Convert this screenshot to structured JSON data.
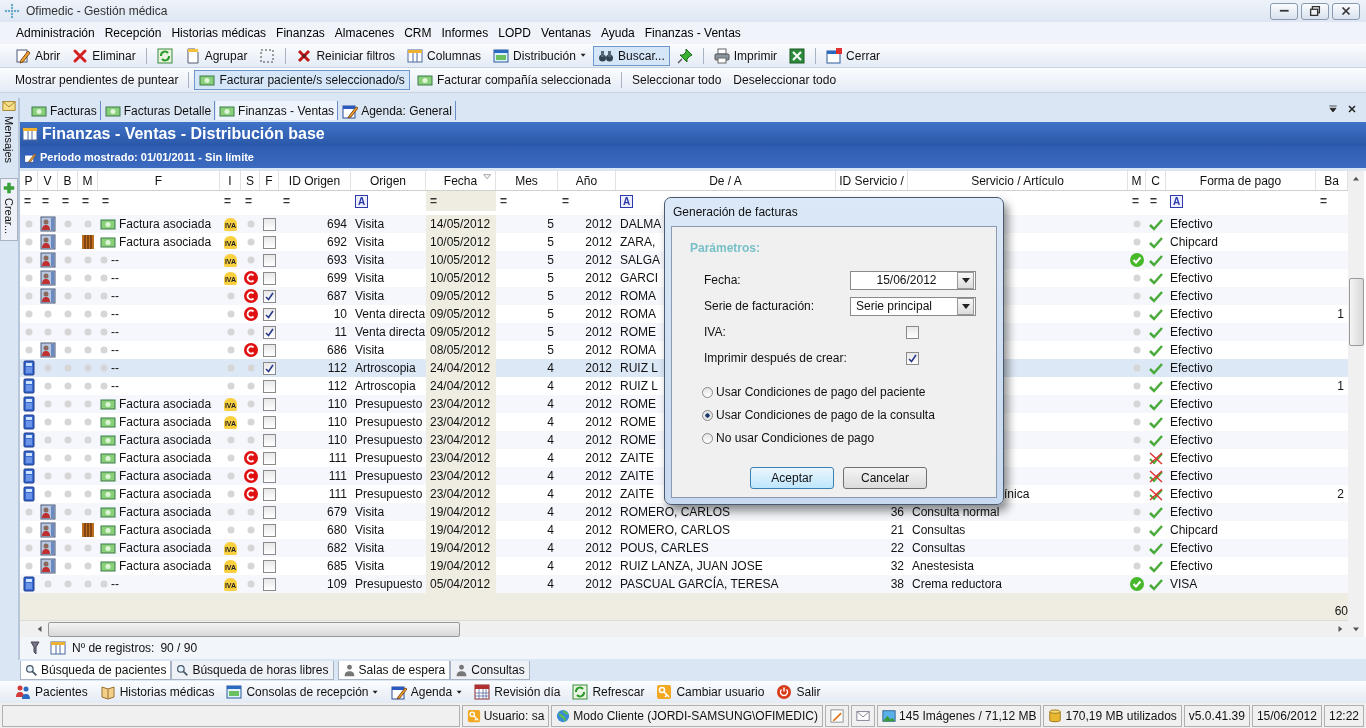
{
  "window": {
    "title": "Ofimedic - Gestión médica"
  },
  "menu": [
    "Administración",
    "Recepción",
    "Historias médicas",
    "Finanzas",
    "Almacenes",
    "CRM",
    "Informes",
    "LOPD",
    "Ventanas",
    "Ayuda",
    "Finanzas - Ventas"
  ],
  "toolbar": [
    {
      "kind": "button",
      "label": "Abrir",
      "selected": false
    },
    {
      "kind": "button",
      "label": "Eliminar",
      "selected": false
    },
    {
      "kind": "icon",
      "selected": false
    },
    {
      "kind": "button",
      "label": "Agrupar",
      "selected": false
    },
    {
      "kind": "icon",
      "selected": false
    },
    {
      "kind": "button",
      "label": "Reiniciar filtros",
      "selected": false
    },
    {
      "kind": "button",
      "label": "Columnas",
      "selected": false
    },
    {
      "kind": "dropdown",
      "label": "Distribución",
      "selected": false
    },
    {
      "kind": "button",
      "label": "Buscar...",
      "selected": true
    },
    {
      "kind": "icon",
      "selected": false
    },
    {
      "kind": "button",
      "label": "Imprimir",
      "selected": false
    },
    {
      "kind": "icon",
      "selected": false
    },
    {
      "kind": "button",
      "label": "Cerrar",
      "selected": false
    }
  ],
  "actions": [
    {
      "label": "Mostrar pendientes de puntear",
      "selected": false
    },
    {
      "label": "Facturar paciente/s seleccionado/s",
      "selected": true
    },
    {
      "label": "Facturar compañía seleccionada",
      "selected": false
    },
    {
      "label": "Seleccionar todo",
      "selected": false
    },
    {
      "label": "Deseleccionar todo",
      "selected": false
    }
  ],
  "side_tabs": [
    "Mensajes",
    "Crear..."
  ],
  "doc_tabs": [
    {
      "label": "Facturas",
      "selected": false
    },
    {
      "label": "Facturas Detalle",
      "selected": false
    },
    {
      "label": "Finanzas - Ventas",
      "selected": true
    },
    {
      "label": "Agenda: General",
      "selected": false
    }
  ],
  "panel": {
    "title": "Finanzas - Ventas - Distribución base",
    "period": "Periodo mostrado: 01/01/2011 - Sin límite"
  },
  "grid": {
    "columns": [
      {
        "label": "P",
        "sorted": false
      },
      {
        "label": "V",
        "sorted": false
      },
      {
        "label": "B",
        "sorted": false
      },
      {
        "label": "M",
        "sorted": false
      },
      {
        "label": "F",
        "sorted": false
      },
      {
        "label": "I",
        "sorted": false
      },
      {
        "label": "S",
        "sorted": false
      },
      {
        "label": "F",
        "sorted": false
      },
      {
        "label": "ID Origen",
        "sorted": false
      },
      {
        "label": "Origen",
        "sorted": false
      },
      {
        "label": "Fecha",
        "sorted": true
      },
      {
        "label": "Mes",
        "sorted": false
      },
      {
        "label": "Año",
        "sorted": false
      },
      {
        "label": "De / A",
        "sorted": false
      },
      {
        "label": "ID Servicio /",
        "sorted": false
      },
      {
        "label": "Servicio / Artículo",
        "sorted": false
      },
      {
        "label": "M",
        "sorted": false
      },
      {
        "label": "C",
        "sorted": false
      },
      {
        "label": "Forma de pago",
        "sorted": false
      },
      {
        "label": "Ba",
        "sorted": false
      }
    ],
    "filters": [
      {
        "kind": "plain",
        "text": "="
      },
      {
        "kind": "plain",
        "text": "="
      },
      {
        "kind": "plain",
        "text": "="
      },
      {
        "kind": "plain",
        "text": "="
      },
      {
        "kind": "plain",
        "text": "="
      },
      {
        "kind": "plain",
        "text": "="
      },
      {
        "kind": "plain",
        "text": "="
      },
      {
        "kind": "none"
      },
      {
        "kind": "plain",
        "text": "="
      },
      {
        "kind": "box",
        "text": "A"
      },
      {
        "kind": "plain",
        "text": "="
      },
      {
        "kind": "plain",
        "text": "="
      },
      {
        "kind": "plain",
        "text": "="
      },
      {
        "kind": "box",
        "text": "A"
      },
      {
        "kind": "none"
      },
      {
        "kind": "none"
      },
      {
        "kind": "plain",
        "text": "="
      },
      {
        "kind": "plain",
        "text": "="
      },
      {
        "kind": "box",
        "text": "A"
      },
      {
        "kind": "plain",
        "text": "="
      }
    ],
    "rows": [
      {
        "calc": false,
        "photo": true,
        "bars": false,
        "invoice": true,
        "f": "Factura asociada",
        "iva": "IVA",
        "coin": false,
        "checked": false,
        "id": "694",
        "origen": "Visita",
        "fecha": "14/05/2012",
        "mes": "5",
        "anio": "2012",
        "de_a": "DALMA",
        "paid": false,
        "rejected": false,
        "pago": "Efectivo",
        "selected": false
      },
      {
        "calc": false,
        "photo": true,
        "bars": true,
        "invoice": true,
        "f": "Factura asociada",
        "iva": "IVA",
        "coin": false,
        "checked": false,
        "id": "692",
        "origen": "Visita",
        "fecha": "10/05/2012",
        "mes": "5",
        "anio": "2012",
        "de_a": "ZARA,",
        "paid": false,
        "rejected": false,
        "pago": "Chipcard",
        "selected": false
      },
      {
        "calc": false,
        "photo": true,
        "bars": false,
        "invoice": false,
        "f": "--",
        "iva": "IVA",
        "coin": false,
        "checked": false,
        "id": "693",
        "origen": "Visita",
        "fecha": "10/05/2012",
        "mes": "5",
        "anio": "2012",
        "de_a": "SALGA",
        "paid": true,
        "rejected": false,
        "pago": "Efectivo",
        "selected": false
      },
      {
        "calc": false,
        "photo": true,
        "bars": false,
        "invoice": false,
        "f": "--",
        "iva": "IVA",
        "coin": true,
        "checked": false,
        "id": "699",
        "origen": "Visita",
        "fecha": "10/05/2012",
        "mes": "5",
        "anio": "2012",
        "de_a": "GARCI",
        "paid": false,
        "rejected": false,
        "pago": "Efectivo",
        "selected": false
      },
      {
        "calc": false,
        "photo": true,
        "bars": false,
        "invoice": false,
        "f": "--",
        "coin": true,
        "checked": true,
        "id": "687",
        "origen": "Visita",
        "fecha": "09/05/2012",
        "mes": "5",
        "anio": "2012",
        "de_a": "ROMA",
        "paid": false,
        "rejected": false,
        "pago": "Efectivo",
        "selected": false
      },
      {
        "calc": false,
        "photo": false,
        "bars": false,
        "invoice": false,
        "f": "--",
        "coin": true,
        "checked": true,
        "id": "10",
        "origen": "Venta directa",
        "fecha": "09/05/2012",
        "mes": "5",
        "anio": "2012",
        "de_a": "ROMA",
        "paid": false,
        "rejected": false,
        "pago": "Efectivo",
        "base": "1",
        "selected": false
      },
      {
        "calc": false,
        "photo": false,
        "bars": false,
        "invoice": false,
        "f": "--",
        "coin": false,
        "checked": true,
        "id": "11",
        "origen": "Venta directa",
        "fecha": "09/05/2012",
        "mes": "5",
        "anio": "2012",
        "de_a": "ROME",
        "paid": false,
        "rejected": false,
        "pago": "Efectivo",
        "selected": false
      },
      {
        "calc": false,
        "photo": true,
        "bars": false,
        "invoice": false,
        "f": "--",
        "coin": true,
        "checked": false,
        "id": "686",
        "origen": "Visita",
        "fecha": "08/05/2012",
        "mes": "5",
        "anio": "2012",
        "de_a": "ROMA",
        "paid": false,
        "rejected": false,
        "pago": "Efectivo",
        "selected": false
      },
      {
        "calc": true,
        "photo": false,
        "bars": false,
        "invoice": false,
        "f": "--",
        "coin": false,
        "checked": true,
        "id": "112",
        "origen": "Artroscopia",
        "fecha": "24/04/2012",
        "mes": "4",
        "anio": "2012",
        "de_a": "RUIZ L",
        "paid": false,
        "rejected": false,
        "pago": "Efectivo",
        "selected": true
      },
      {
        "calc": true,
        "photo": false,
        "bars": false,
        "invoice": false,
        "f": "--",
        "coin": false,
        "checked": false,
        "id": "112",
        "origen": "Artroscopia",
        "fecha": "24/04/2012",
        "mes": "4",
        "anio": "2012",
        "de_a": "RUIZ L",
        "paid": false,
        "rejected": false,
        "pago": "Efectivo",
        "base": "1",
        "selected": false
      },
      {
        "calc": true,
        "photo": false,
        "bars": false,
        "invoice": true,
        "f": "Factura asociada",
        "iva": "IVA",
        "coin": false,
        "checked": false,
        "id": "110",
        "origen": "Presupuesto",
        "fecha": "23/04/2012",
        "mes": "4",
        "anio": "2012",
        "de_a": "ROME",
        "paid": false,
        "rejected": false,
        "pago": "Efectivo",
        "selected": false
      },
      {
        "calc": true,
        "photo": false,
        "bars": false,
        "invoice": true,
        "f": "Factura asociada",
        "iva": "IVA",
        "coin": false,
        "checked": false,
        "id": "110",
        "origen": "Presupuesto",
        "fecha": "23/04/2012",
        "mes": "4",
        "anio": "2012",
        "de_a": "ROME",
        "paid": false,
        "rejected": false,
        "pago": "Efectivo",
        "selected": false
      },
      {
        "calc": true,
        "photo": false,
        "bars": false,
        "invoice": true,
        "f": "Factura asociada",
        "coin": false,
        "checked": false,
        "id": "110",
        "origen": "Presupuesto",
        "fecha": "23/04/2012",
        "mes": "4",
        "anio": "2012",
        "de_a": "ROME",
        "paid": false,
        "rejected": false,
        "pago": "Efectivo",
        "selected": false
      },
      {
        "calc": true,
        "photo": false,
        "bars": false,
        "invoice": true,
        "f": "Factura asociada",
        "coin": true,
        "checked": false,
        "id": "111",
        "origen": "Presupuesto",
        "fecha": "23/04/2012",
        "mes": "4",
        "anio": "2012",
        "de_a": "ZAITE",
        "paid": false,
        "rejected": true,
        "pago": "Efectivo",
        "selected": false
      },
      {
        "calc": true,
        "photo": false,
        "bars": false,
        "invoice": true,
        "f": "Factura asociada",
        "coin": true,
        "checked": false,
        "id": "111",
        "origen": "Presupuesto",
        "fecha": "23/04/2012",
        "mes": "4",
        "anio": "2012",
        "de_a": "ZAITE",
        "paid": false,
        "rejected": true,
        "pago": "Efectivo",
        "selected": false
      },
      {
        "calc": true,
        "photo": false,
        "bars": false,
        "invoice": true,
        "f": "Factura asociada",
        "coin": true,
        "checked": false,
        "id": "111",
        "origen": "Presupuesto",
        "fecha": "23/04/2012",
        "mes": "4",
        "anio": "2012",
        "de_a": "ZAITE",
        "servicio": "ínica",
        "covered": true,
        "paid": false,
        "rejected": true,
        "pago": "Efectivo",
        "base": "2",
        "selected": false
      },
      {
        "calc": false,
        "photo": true,
        "bars": false,
        "invoice": true,
        "f": "Factura asociada",
        "coin": false,
        "checked": false,
        "id": "679",
        "origen": "Visita",
        "fecha": "19/04/2012",
        "mes": "4",
        "anio": "2012",
        "de_a": "ROMERO, CARLOS",
        "id_servicio": "36",
        "servicio": "Consulta normal",
        "paid": false,
        "rejected": false,
        "pago": "Efectivo",
        "selected": false
      },
      {
        "calc": false,
        "photo": true,
        "bars": true,
        "invoice": true,
        "f": "Factura asociada",
        "coin": false,
        "checked": false,
        "id": "680",
        "origen": "Visita",
        "fecha": "19/04/2012",
        "mes": "4",
        "anio": "2012",
        "de_a": "ROMERO, CARLOS",
        "id_servicio": "21",
        "servicio": "Consultas",
        "paid": false,
        "rejected": false,
        "pago": "Chipcard",
        "selected": false
      },
      {
        "calc": false,
        "photo": true,
        "bars": false,
        "invoice": true,
        "f": "Factura asociada",
        "iva": "IVA",
        "coin": false,
        "checked": false,
        "id": "682",
        "origen": "Visita",
        "fecha": "19/04/2012",
        "mes": "4",
        "anio": "2012",
        "de_a": "POUS, CARLES",
        "id_servicio": "22",
        "servicio": "Consultas",
        "paid": false,
        "rejected": false,
        "pago": "Efectivo",
        "selected": false
      },
      {
        "calc": false,
        "photo": true,
        "bars": false,
        "invoice": true,
        "f": "Factura asociada",
        "iva": "IVA",
        "coin": false,
        "checked": false,
        "id": "685",
        "origen": "Visita",
        "fecha": "19/04/2012",
        "mes": "4",
        "anio": "2012",
        "de_a": "RUIZ LANZA, JUAN JOSE",
        "id_servicio": "32",
        "servicio": "Anestesista",
        "paid": false,
        "rejected": false,
        "pago": "Efectivo",
        "selected": false
      },
      {
        "calc": true,
        "photo": false,
        "bars": false,
        "invoice": false,
        "f": "--",
        "iva": "IVA",
        "coin": false,
        "checked": false,
        "id": "109",
        "origen": "Presupuesto",
        "fecha": "05/04/2012",
        "mes": "4",
        "anio": "2012",
        "de_a": "PASCUAL GARCÍA, TERESA",
        "id_servicio": "38",
        "servicio": "Crema reductora",
        "paid": true,
        "rejected": false,
        "pago": "VISA",
        "selected": false
      }
    ],
    "footer": {
      "base": "60"
    }
  },
  "record_count": {
    "label": "Nº de registros:",
    "value": "90 / 90"
  },
  "dialog": {
    "title": "Generación de facturas",
    "section": "Parámetros:",
    "fields": [
      {
        "kind": "date",
        "label": "Fecha:",
        "value": "15/06/2012"
      },
      {
        "kind": "dropdown",
        "label": "Serie de facturación:",
        "value": "Serie principal"
      },
      {
        "kind": "checkbox",
        "label": "IVA:",
        "checked": false
      },
      {
        "kind": "checkbox",
        "label": "Imprimir después de crear:",
        "checked": true
      }
    ],
    "options": [
      {
        "label": "Usar Condiciones de pago del paciente",
        "selected": false
      },
      {
        "label": "Usar Condiciones de pago de la consulta",
        "selected": true
      },
      {
        "label": "No usar Condiciones de pago",
        "selected": false
      }
    ],
    "buttons": [
      {
        "label": "Aceptar",
        "default": true
      },
      {
        "label": "Cancelar",
        "default": false
      }
    ]
  },
  "bottom_tabs": [
    {
      "label": "Búsqueda de pacientes",
      "selected": true
    },
    {
      "label": "Búsqueda de horas libres",
      "selected": false
    },
    {
      "label": "Salas de espera",
      "selected": true
    },
    {
      "label": "Consultas",
      "selected": false
    }
  ],
  "launcher": [
    {
      "kind": "button",
      "label": "Pacientes"
    },
    {
      "kind": "button",
      "label": "Historias médicas"
    },
    {
      "kind": "dropdown",
      "label": "Consolas de recepción"
    },
    {
      "kind": "dropdown",
      "label": "Agenda"
    },
    {
      "kind": "button",
      "label": "Revisión día"
    },
    {
      "kind": "button",
      "label": "Refrescar"
    },
    {
      "kind": "button",
      "label": "Cambiar usuario"
    },
    {
      "kind": "button",
      "label": "Salir"
    }
  ],
  "status_bar": [
    {
      "kind": "text",
      "label": "Usuario: sa"
    },
    {
      "kind": "text",
      "label": "Modo Cliente (JORDI-SAMSUNG\\OFIMEDIC)"
    },
    {
      "kind": "icon"
    },
    {
      "kind": "icon"
    },
    {
      "kind": "text",
      "label": "145 Imágenes / 71,12 MB"
    },
    {
      "kind": "text",
      "label": "170,19 MB utilizados"
    },
    {
      "kind": "text",
      "label": "v5.0.41.39"
    },
    {
      "kind": "text",
      "label": "15/06/2012"
    },
    {
      "kind": "text",
      "label": "12:22"
    }
  ]
}
